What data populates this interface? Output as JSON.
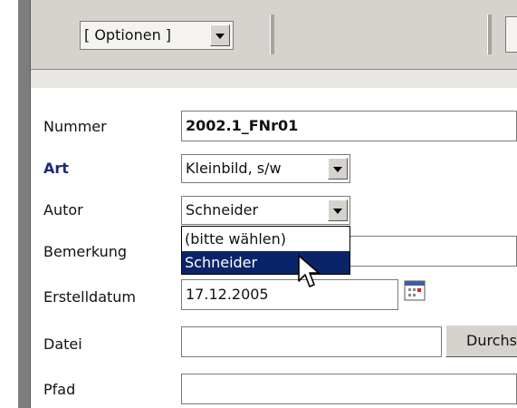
{
  "toolbar": {
    "options_label": "[ Optionen ]"
  },
  "form": {
    "nummer": {
      "label": "Nummer",
      "value": "2002.1_FNr01"
    },
    "art": {
      "label": "Art",
      "value": "Kleinbild, s/w"
    },
    "autor": {
      "label": "Autor",
      "value": "Schneider",
      "options": [
        "(bitte wählen)",
        "Schneider"
      ],
      "highlighted": "Schneider"
    },
    "bemerkung": {
      "label": "Bemerkung",
      "value": ""
    },
    "erstelldatum": {
      "label": "Erstelldatum",
      "value": "17.12.2005"
    },
    "datei": {
      "label": "Datei",
      "value": "",
      "browse_label": "Durchsuchen"
    },
    "pfad": {
      "label": "Pfad",
      "value": ""
    }
  },
  "colors": {
    "toolbar_bg": "#d6d3ce",
    "highlight": "#0a246a",
    "label_emphasis": "#1a2a78"
  },
  "icons": [
    "chevron-down-icon",
    "calendar-icon",
    "mouse-pointer-icon"
  ]
}
